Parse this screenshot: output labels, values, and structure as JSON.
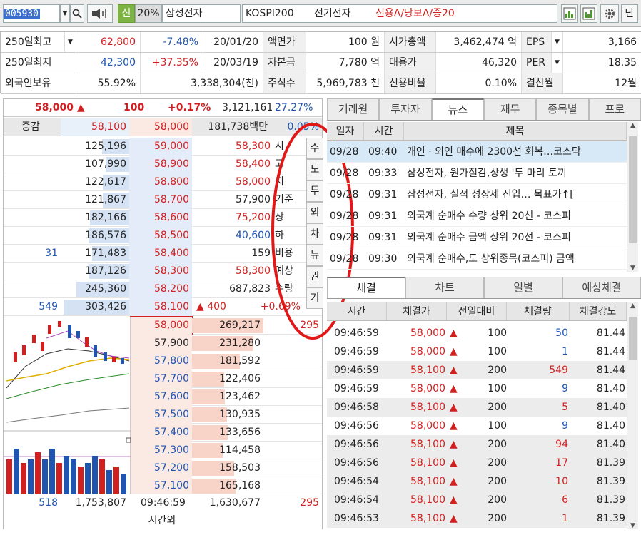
{
  "toolbar": {
    "code": "005930",
    "credit_tag": "신",
    "margin": "20%",
    "name": "삼성전자",
    "market": "KOSPI200",
    "sector": "전기전자",
    "credit_info": "신용A/당보A/증20",
    "single_btn": "단"
  },
  "info": {
    "row1": {
      "label": "250일최고",
      "price": "62,800",
      "rate": "-7.48%",
      "date": "20/01/20",
      "l2": "액면가",
      "v2": "100 원",
      "l3": "시가총액",
      "v3": "3,462,474 억",
      "l4": "EPS",
      "v4": "3,166"
    },
    "row2": {
      "label": "250일최저",
      "price": "42,300",
      "rate": "+37.35%",
      "date": "20/03/19",
      "l2": "자본금",
      "v2": "7,780 억",
      "l3": "대용가",
      "v3": "46,320",
      "l4": "PER",
      "v4": "18.35"
    },
    "row3": {
      "label": "외국인보유",
      "rate": "55.92%",
      "amount": "3,338,304(천)",
      "l2": "주식수",
      "v2": "5,969,783 천",
      "l3": "신용비율",
      "v3": "0.10%",
      "l4": "결산월",
      "v4": "12월"
    }
  },
  "quote": {
    "price": "58,000",
    "arrow": "▲",
    "change": "100",
    "pct": "+0.17%",
    "volume": "3,121,161",
    "ratio": "27.27%"
  },
  "orderbook": {
    "header": {
      "label": "증감",
      "ask_price": "58,100",
      "bid_price": "58,000",
      "amount": "181,738백만",
      "pct": "0.05%"
    },
    "asks": [
      {
        "qty": "125,196",
        "price": "59,000"
      },
      {
        "qty": "107,990",
        "price": "58,900"
      },
      {
        "qty": "122,617",
        "price": "58,800"
      },
      {
        "qty": "121,867",
        "price": "58,700"
      },
      {
        "qty": "182,166",
        "price": "58,600"
      },
      {
        "qty": "186,576",
        "price": "58,500"
      },
      {
        "qty": "171,483",
        "price": "58,400",
        "chg": "31"
      },
      {
        "qty": "187,126",
        "price": "58,300"
      },
      {
        "qty": "245,360",
        "price": "58,200"
      },
      {
        "qty": "303,426",
        "price": "58,100",
        "chg": "549"
      }
    ],
    "bids": [
      {
        "price": "58,000",
        "qty": "269,217",
        "chg": "295"
      },
      {
        "price": "57,900",
        "qty": "231,280"
      },
      {
        "price": "57,800",
        "qty": "181,592"
      },
      {
        "price": "57,700",
        "qty": "122,406"
      },
      {
        "price": "57,600",
        "qty": "123,462"
      },
      {
        "price": "57,500",
        "qty": "130,935"
      },
      {
        "price": "57,400",
        "qty": "133,656"
      },
      {
        "price": "57,300",
        "qty": "114,458"
      },
      {
        "price": "57,200",
        "qty": "158,503"
      },
      {
        "price": "57,100",
        "qty": "165,168"
      }
    ],
    "summary": [
      {
        "label": "시",
        "value": "58,300"
      },
      {
        "label": "고",
        "value": "58,400"
      },
      {
        "label": "저",
        "value": "58,000"
      },
      {
        "label": "기준",
        "value": "57,900"
      },
      {
        "label": "상",
        "value": "75,200"
      },
      {
        "label": "하",
        "value": "40,600"
      },
      {
        "label": "비용",
        "value": "159"
      },
      {
        "label": "예상",
        "value": "58,300"
      },
      {
        "label": "수량",
        "value": "687,823"
      },
      {
        "label": "",
        "value": "▲ 400",
        "pct": "+0.69%"
      }
    ],
    "footer": {
      "left_chg": "518",
      "ask_total": "1,753,807",
      "time": "09:46:59",
      "time_label": "시간외",
      "bid_total": "1,630,677",
      "right_chg": "295"
    }
  },
  "side_buttons": [
    "수",
    "도",
    "투",
    "외",
    "차",
    "뉴",
    "권",
    "기"
  ],
  "news": {
    "tabs": [
      "거래원",
      "투자자",
      "뉴스",
      "재무",
      "종목별",
      "프로"
    ],
    "active_tab": 2,
    "headers": [
      "일자",
      "시간",
      "제목"
    ],
    "rows": [
      {
        "date": "09/28",
        "time": "09:40",
        "title": "개인 · 외인 매수에 2300선 회복…코스닥"
      },
      {
        "date": "09/28",
        "time": "09:33",
        "title": "삼성전자, 원가절감,상생 '두 마리 토끼"
      },
      {
        "date": "09/28",
        "time": "09:31",
        "title": "삼성전자, 실적 성장세 진입… 목표가↑["
      },
      {
        "date": "09/28",
        "time": "09:31",
        "title": "외국계 순매수 수량 상위 20선 - 코스피"
      },
      {
        "date": "09/28",
        "time": "09:31",
        "title": "외국계 순매수 금액 상위 20선 - 코스피"
      },
      {
        "date": "09/28",
        "time": "09:30",
        "title": "외국계 순매수,도 상위종목(코스피) 금액"
      }
    ]
  },
  "trades": {
    "tabs": [
      "체결",
      "차트",
      "일별",
      "예상체결"
    ],
    "active_tab": 0,
    "headers": [
      "시간",
      "체결가",
      "전일대비",
      "체결량",
      "체결강도"
    ],
    "rows": [
      {
        "time": "09:46:59",
        "price": "58,000",
        "chg": "100",
        "qty": "50",
        "str": "81.44",
        "side": "buy"
      },
      {
        "time": "09:46:59",
        "price": "58,000",
        "chg": "100",
        "qty": "1",
        "str": "81.44",
        "side": "buy"
      },
      {
        "time": "09:46:59",
        "price": "58,100",
        "chg": "200",
        "qty": "549",
        "str": "81.44",
        "side": "sell"
      },
      {
        "time": "09:46:59",
        "price": "58,000",
        "chg": "100",
        "qty": "9",
        "str": "81.40",
        "side": "buy"
      },
      {
        "time": "09:46:58",
        "price": "58,100",
        "chg": "200",
        "qty": "5",
        "str": "81.40",
        "side": "sell"
      },
      {
        "time": "09:46:56",
        "price": "58,000",
        "chg": "100",
        "qty": "9",
        "str": "81.40",
        "side": "buy"
      },
      {
        "time": "09:46:56",
        "price": "58,100",
        "chg": "200",
        "qty": "94",
        "str": "81.40",
        "side": "sell"
      },
      {
        "time": "09:46:56",
        "price": "58,100",
        "chg": "200",
        "qty": "17",
        "str": "81.39",
        "side": "sell"
      },
      {
        "time": "09:46:54",
        "price": "58,100",
        "chg": "200",
        "qty": "10",
        "str": "81.39",
        "side": "sell"
      },
      {
        "time": "09:46:54",
        "price": "58,100",
        "chg": "200",
        "qty": "6",
        "str": "81.39",
        "side": "sell"
      },
      {
        "time": "09:46:53",
        "price": "58,100",
        "chg": "200",
        "qty": "1",
        "str": "81.39",
        "side": "sell"
      }
    ]
  },
  "colors": {
    "up": "#d02020",
    "down": "#1f55b0",
    "ask_bg": "#e8f0fa",
    "bid_bg": "#fbe9e4",
    "annotation": "#e01818"
  },
  "icons": [
    "dropdown-arrow-icon",
    "search-icon",
    "speaker-icon",
    "chart-window-icon",
    "chart-window-2-icon",
    "gear-icon",
    "scroll-up-icon",
    "scroll-down-icon",
    "close-icon"
  ]
}
